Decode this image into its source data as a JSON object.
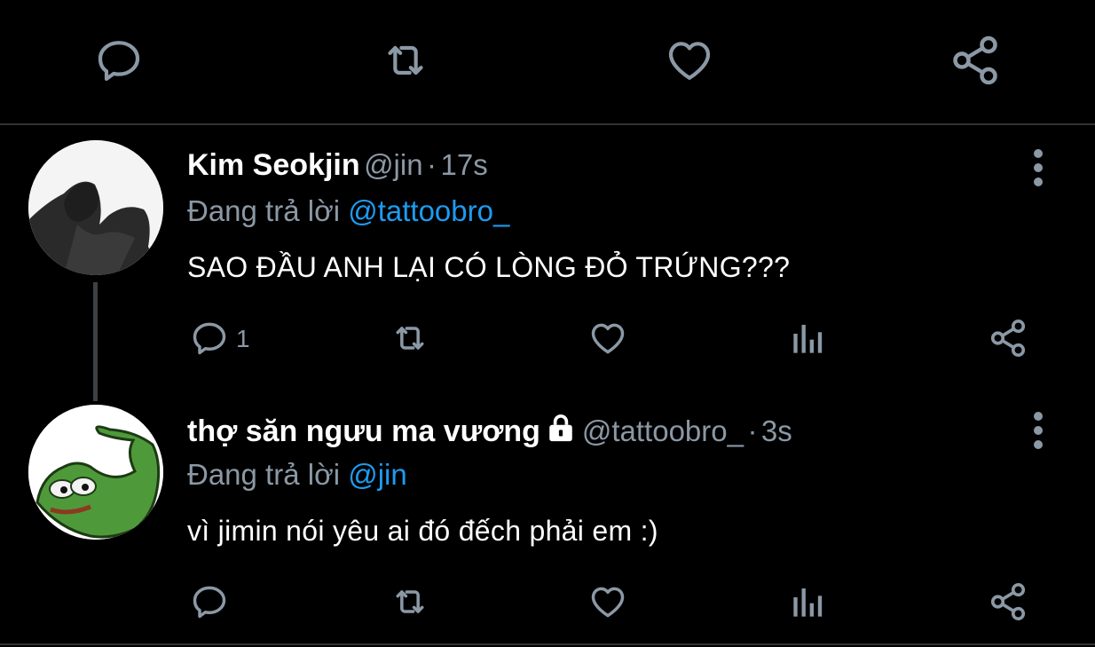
{
  "tweets": [
    {
      "name": "Kim Seokjin",
      "handle": "@jin",
      "separator": "·",
      "time": "17s",
      "reply_prefix": "Đang trả lời",
      "reply_to": "@tattoobro_",
      "text": "SAO ĐẦU ANH LẠI CÓ LÒNG ĐỎ TRỨNG???",
      "reply_count": "1"
    },
    {
      "name": "thợ săn ngưu ma vương",
      "handle": "@tattoobro_",
      "separator": "·",
      "time": "3s",
      "reply_prefix": "Đang trả lời",
      "reply_to": "@jin",
      "text": "vì jimin nói yêu ai đó đếch phải em :)",
      "reply_count": ""
    }
  ],
  "icons": {
    "reply": "reply-icon",
    "retweet": "retweet-icon",
    "like": "like-icon",
    "share": "share-icon",
    "views": "views-icon",
    "more": "more-vertical-icon",
    "lock": "lock-icon"
  },
  "colors": {
    "background": "#000000",
    "text": "#ffffff",
    "muted": "#8b98a5",
    "mention": "#1d9bf0",
    "divider": "#2f3336"
  }
}
